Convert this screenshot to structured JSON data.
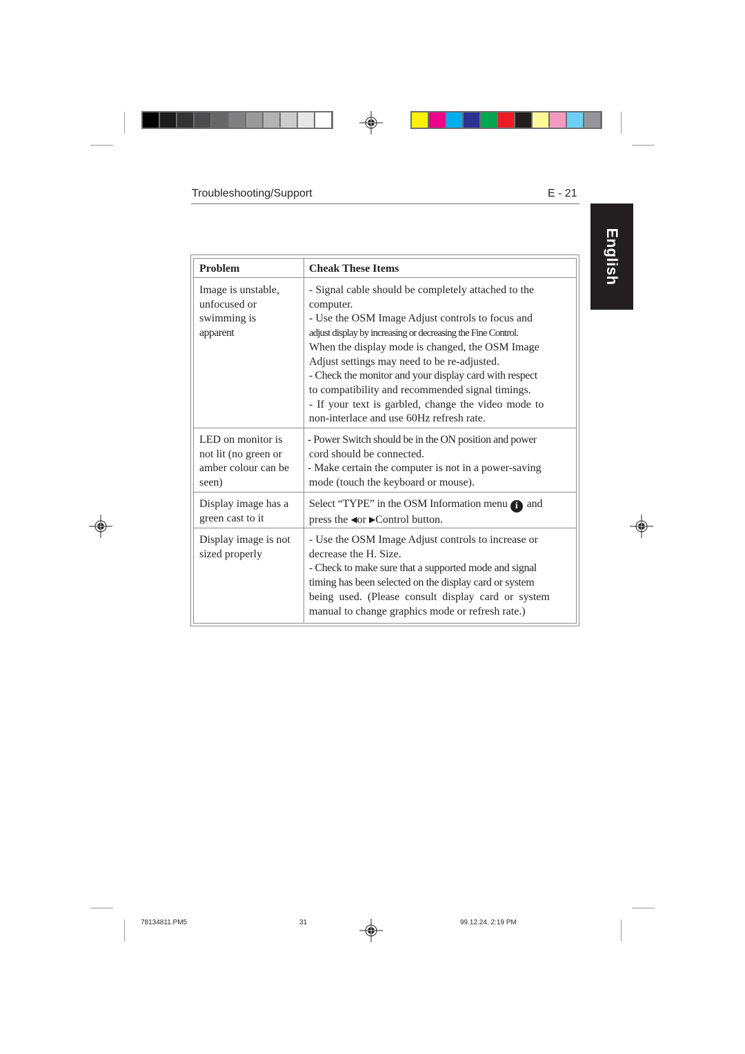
{
  "print_marks": {
    "grayscale_swatches": [
      "#000000",
      "#1c1c1c",
      "#333333",
      "#4d4d4d",
      "#666666",
      "#808080",
      "#999999",
      "#b3b3b3",
      "#cccccc",
      "#e6e6e6",
      "#ffffff"
    ],
    "color_swatches": [
      "#fff200",
      "#ec008c",
      "#00aeef",
      "#2e3192",
      "#00a651",
      "#ed1c24",
      "#231f20",
      "#fff799",
      "#f49ac1",
      "#6dcff6",
      "#939598"
    ]
  },
  "header": {
    "section_title": "Troubleshooting/Support",
    "page_number": "E - 21"
  },
  "language_tab": "English",
  "table": {
    "columns": [
      "Problem",
      "Cheak These Items"
    ],
    "rows": [
      {
        "problem_lines": [
          "Image is unstable,",
          "unfocused or",
          "swimming is",
          "apparent"
        ],
        "check_lines": [
          "- Signal cable should be completely attached to the",
          "computer.",
          "- Use the OSM Image Adjust controls to focus and",
          "adjust display by increasing or decreasing the Fine Control.",
          "When the display mode is changed, the OSM Image",
          "Adjust settings may need to be re-adjusted.",
          "- Check the monitor and your display card with respect",
          "to compatibility and recommended signal timings.",
          "- If your text is garbled, change the video mode to",
          "non-interlace and use 60Hz refresh rate."
        ]
      },
      {
        "problem_lines": [
          "LED on monitor is",
          "not lit (no green or",
          "amber colour can be",
          "seen)"
        ],
        "check_lines": [
          "- Power Switch should be in the ON position and power",
          "cord should be connected.",
          "- Make certain the computer is not in a power-saving",
          "mode (touch the keyboard or mouse)."
        ]
      },
      {
        "problem_lines": [
          "Display image has a",
          "green cast to it"
        ],
        "check_parts": {
          "line1_before_icon": "Select “TYPE” in the OSM Information menu",
          "info_icon_glyph": "i",
          "line1_after_icon": "and",
          "line2_prefix": "press the",
          "left_arrow": "◀",
          "or": "or",
          "right_arrow": "▶",
          "line2_suffix": "Control button."
        }
      },
      {
        "problem_lines": [
          "Display image is not",
          "sized properly"
        ],
        "check_lines": [
          "- Use the OSM Image Adjust controls to increase or",
          "decrease the H. Size.",
          "- Check to make sure that a supported mode and signal",
          "timing has been selected on the display card or system",
          "being used. (Please consult display card or system",
          "manual to change graphics mode or refresh rate.)"
        ]
      }
    ]
  },
  "footer": {
    "file_name": "78134811.PM5",
    "sheet_number": "31",
    "timestamp": "99.12.24, 2:19 PM"
  }
}
